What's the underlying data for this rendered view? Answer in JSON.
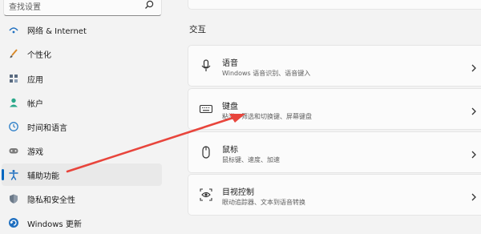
{
  "search": {
    "placeholder": "查找设置"
  },
  "sidebar": {
    "items": [
      {
        "label": "网络 & Internet",
        "icon": "network-icon"
      },
      {
        "label": "个性化",
        "icon": "brush-icon"
      },
      {
        "label": "应用",
        "icon": "apps-icon"
      },
      {
        "label": "帐户",
        "icon": "account-icon"
      },
      {
        "label": "时间和语言",
        "icon": "globe-clock-icon"
      },
      {
        "label": "游戏",
        "icon": "gamepad-icon"
      },
      {
        "label": "辅助功能",
        "icon": "accessibility-icon",
        "selected": true
      },
      {
        "label": "隐私和安全性",
        "icon": "shield-icon"
      },
      {
        "label": "Windows 更新",
        "icon": "update-icon"
      }
    ]
  },
  "main": {
    "section_title": "交互",
    "cards": [
      {
        "title": "语音",
        "subtitle": "Windows 语音识别、语音键入",
        "icon": "microphone-icon"
      },
      {
        "title": "键盘",
        "subtitle": "粘滞、筛选和切换键、屏幕键盘",
        "icon": "keyboard-icon"
      },
      {
        "title": "鼠标",
        "subtitle": "鼠标键、速度、加速",
        "icon": "mouse-icon"
      },
      {
        "title": "目视控制",
        "subtitle": "眼动追踪器、文本到语音转换",
        "icon": "eye-control-icon"
      }
    ]
  },
  "colors": {
    "accent": "#0067c0",
    "annotation_arrow": "#e8453c"
  }
}
